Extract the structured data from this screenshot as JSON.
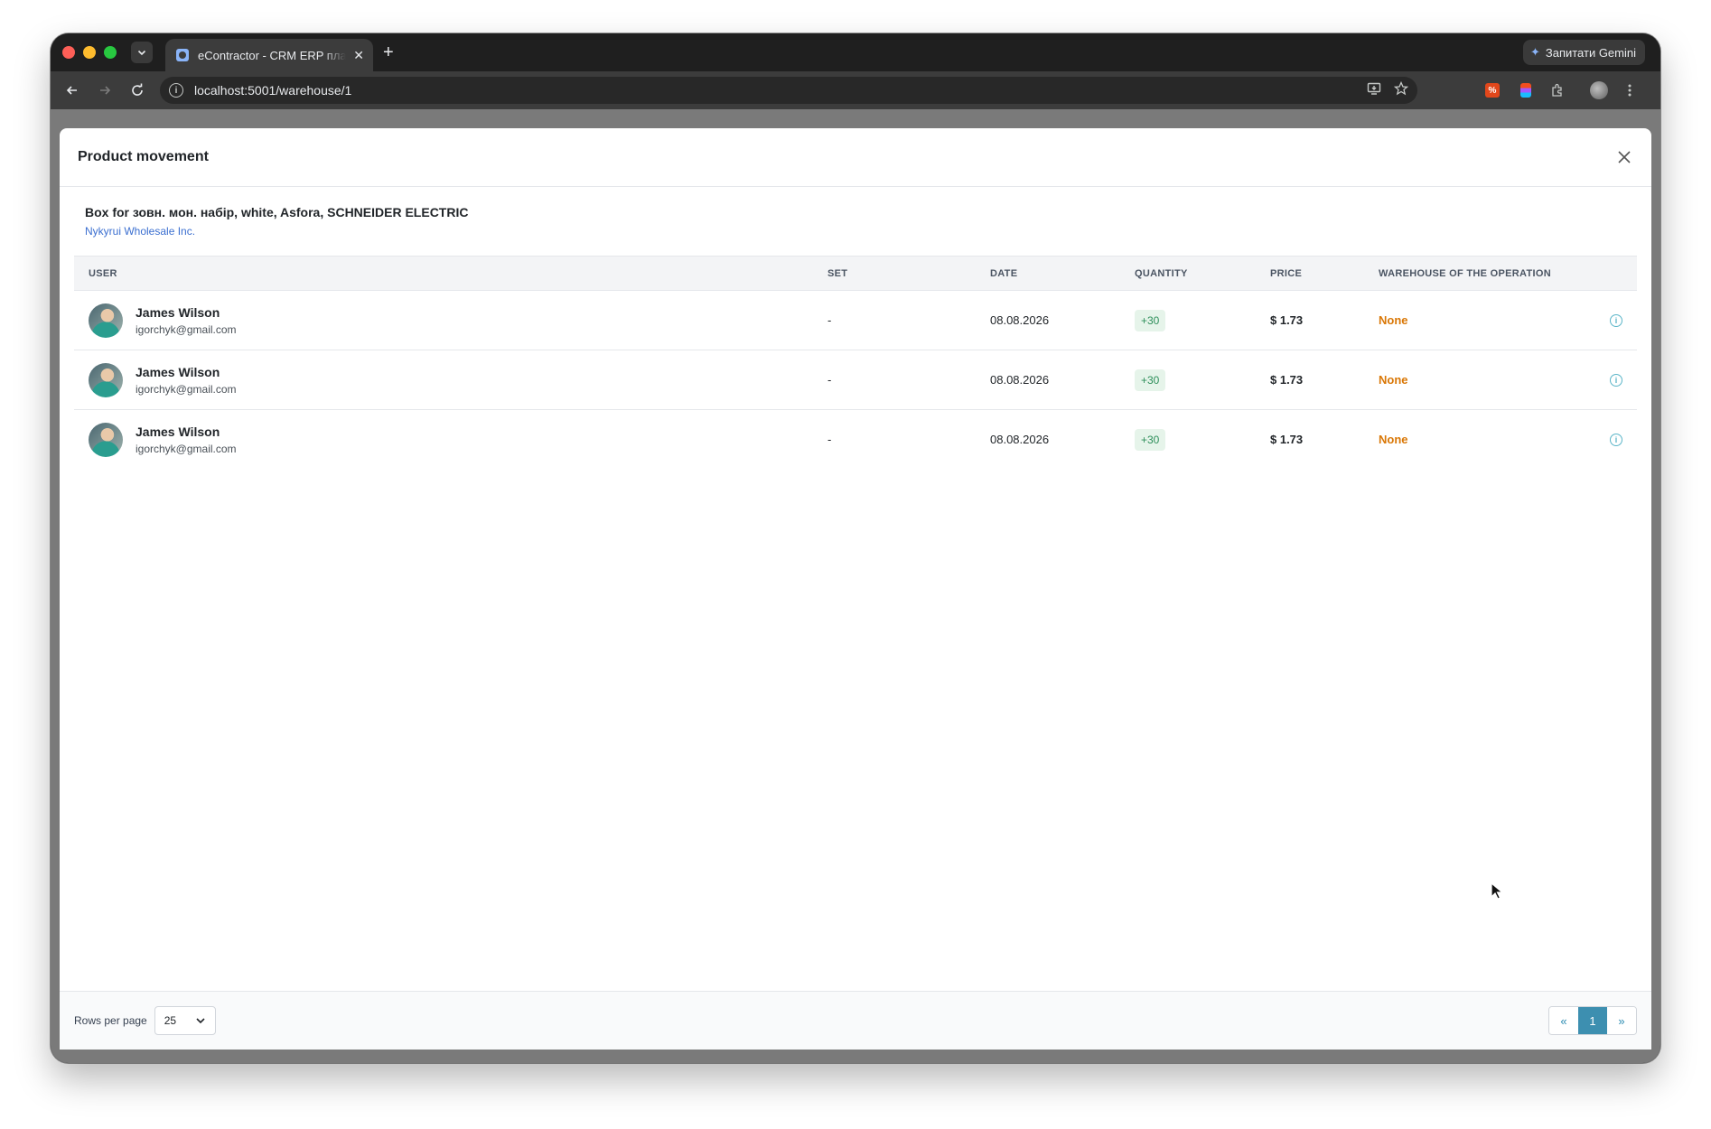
{
  "browser": {
    "tab_title": "eContractor - CRM ERP платформа",
    "url": "localhost:5001/warehouse/1",
    "gemini_label": "Запитати Gemini"
  },
  "modal": {
    "title": "Product movement",
    "product_name": "Box for зовн. мон. набір, white, Asfora, SCHNEIDER ELECTRIC",
    "supplier": "Nykyrui Wholesale Inc."
  },
  "table": {
    "headers": {
      "user": "USER",
      "set": "SET",
      "date": "DATE",
      "quantity": "QUANTITY",
      "price": "PRICE",
      "warehouse": "WAREHOUSE OF THE OPERATION"
    },
    "rows": [
      {
        "name": "James Wilson",
        "email": "igorchyk@gmail.com",
        "set": "-",
        "date": "08.08.2026",
        "quantity": "+30",
        "price": "$ 1.73",
        "warehouse": "None"
      },
      {
        "name": "James Wilson",
        "email": "igorchyk@gmail.com",
        "set": "-",
        "date": "08.08.2026",
        "quantity": "+30",
        "price": "$ 1.73",
        "warehouse": "None"
      },
      {
        "name": "James Wilson",
        "email": "igorchyk@gmail.com",
        "set": "-",
        "date": "08.08.2026",
        "quantity": "+30",
        "price": "$ 1.73",
        "warehouse": "None"
      }
    ]
  },
  "footer": {
    "rows_per_page_label": "Rows per page",
    "rows_per_page_value": "25",
    "pager_prev": "«",
    "pager_current": "1",
    "pager_next": "»"
  },
  "colors": {
    "quantity_badge_bg": "#e6f4ea",
    "quantity_badge_text": "#2f8f5b",
    "warehouse_none": "#d97706",
    "pager_active": "#3d8fb0",
    "link": "#3b6fd0"
  },
  "icons": [
    "close-icon",
    "info-icon",
    "chevron-down-icon",
    "back-icon",
    "forward-icon",
    "reload-icon",
    "star-icon",
    "extensions-icon",
    "more-icon"
  ]
}
